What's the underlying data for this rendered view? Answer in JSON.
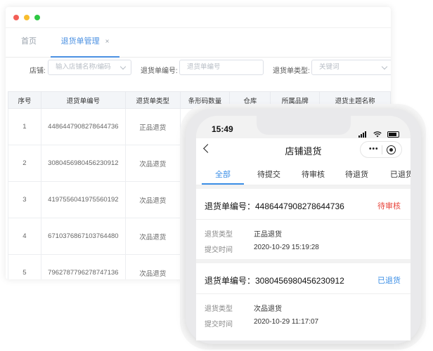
{
  "desktop": {
    "tabs": {
      "home": "首页",
      "active": "退货单管理",
      "close": "×"
    },
    "filters": {
      "shop_label": "店铺:",
      "shop_placeholder": "输入店铺名称/编码",
      "no_label": "退货单编号:",
      "no_placeholder": "退货单编号",
      "type_label": "退货单类型:",
      "type_placeholder": "关键词"
    },
    "table": {
      "headers": [
        "序号",
        "退货单编号",
        "退货单类型",
        "条形码数量",
        "仓库",
        "所属品牌",
        "退货主题名称"
      ],
      "rows": [
        {
          "index": "1",
          "no": "4486447908278644736",
          "type": "正品退货"
        },
        {
          "index": "2",
          "no": "3080456980456230912",
          "type": "次品退货"
        },
        {
          "index": "3",
          "no": "4197556041975560192",
          "type": "次品退货"
        },
        {
          "index": "4",
          "no": "6710376867103764480",
          "type": "次品退货"
        },
        {
          "index": "5",
          "no": "7962787796278747136",
          "type": "次品退货"
        }
      ]
    }
  },
  "mobile": {
    "time": "15:49",
    "title": "店铺退货",
    "capsule_more": "•••",
    "tabs": [
      "全部",
      "待提交",
      "待审核",
      "待退货",
      "已退货"
    ],
    "cards": [
      {
        "no_label": "退货单编号：4486447908278644736",
        "status": "待审核",
        "status_color": "#e8453c",
        "type_label": "退货类型",
        "type_value": "正品退货",
        "time_label": "提交时间",
        "time_value": "2020-10-29 15:19:28"
      },
      {
        "no_label": "退货单编号：3080456980456230912",
        "status": "已退货",
        "status_color": "#3a8ee6",
        "type_label": "退货类型",
        "type_value": "次品退货",
        "time_label": "提交时间",
        "time_value": "2020-10-29 11:17:07"
      }
    ]
  }
}
